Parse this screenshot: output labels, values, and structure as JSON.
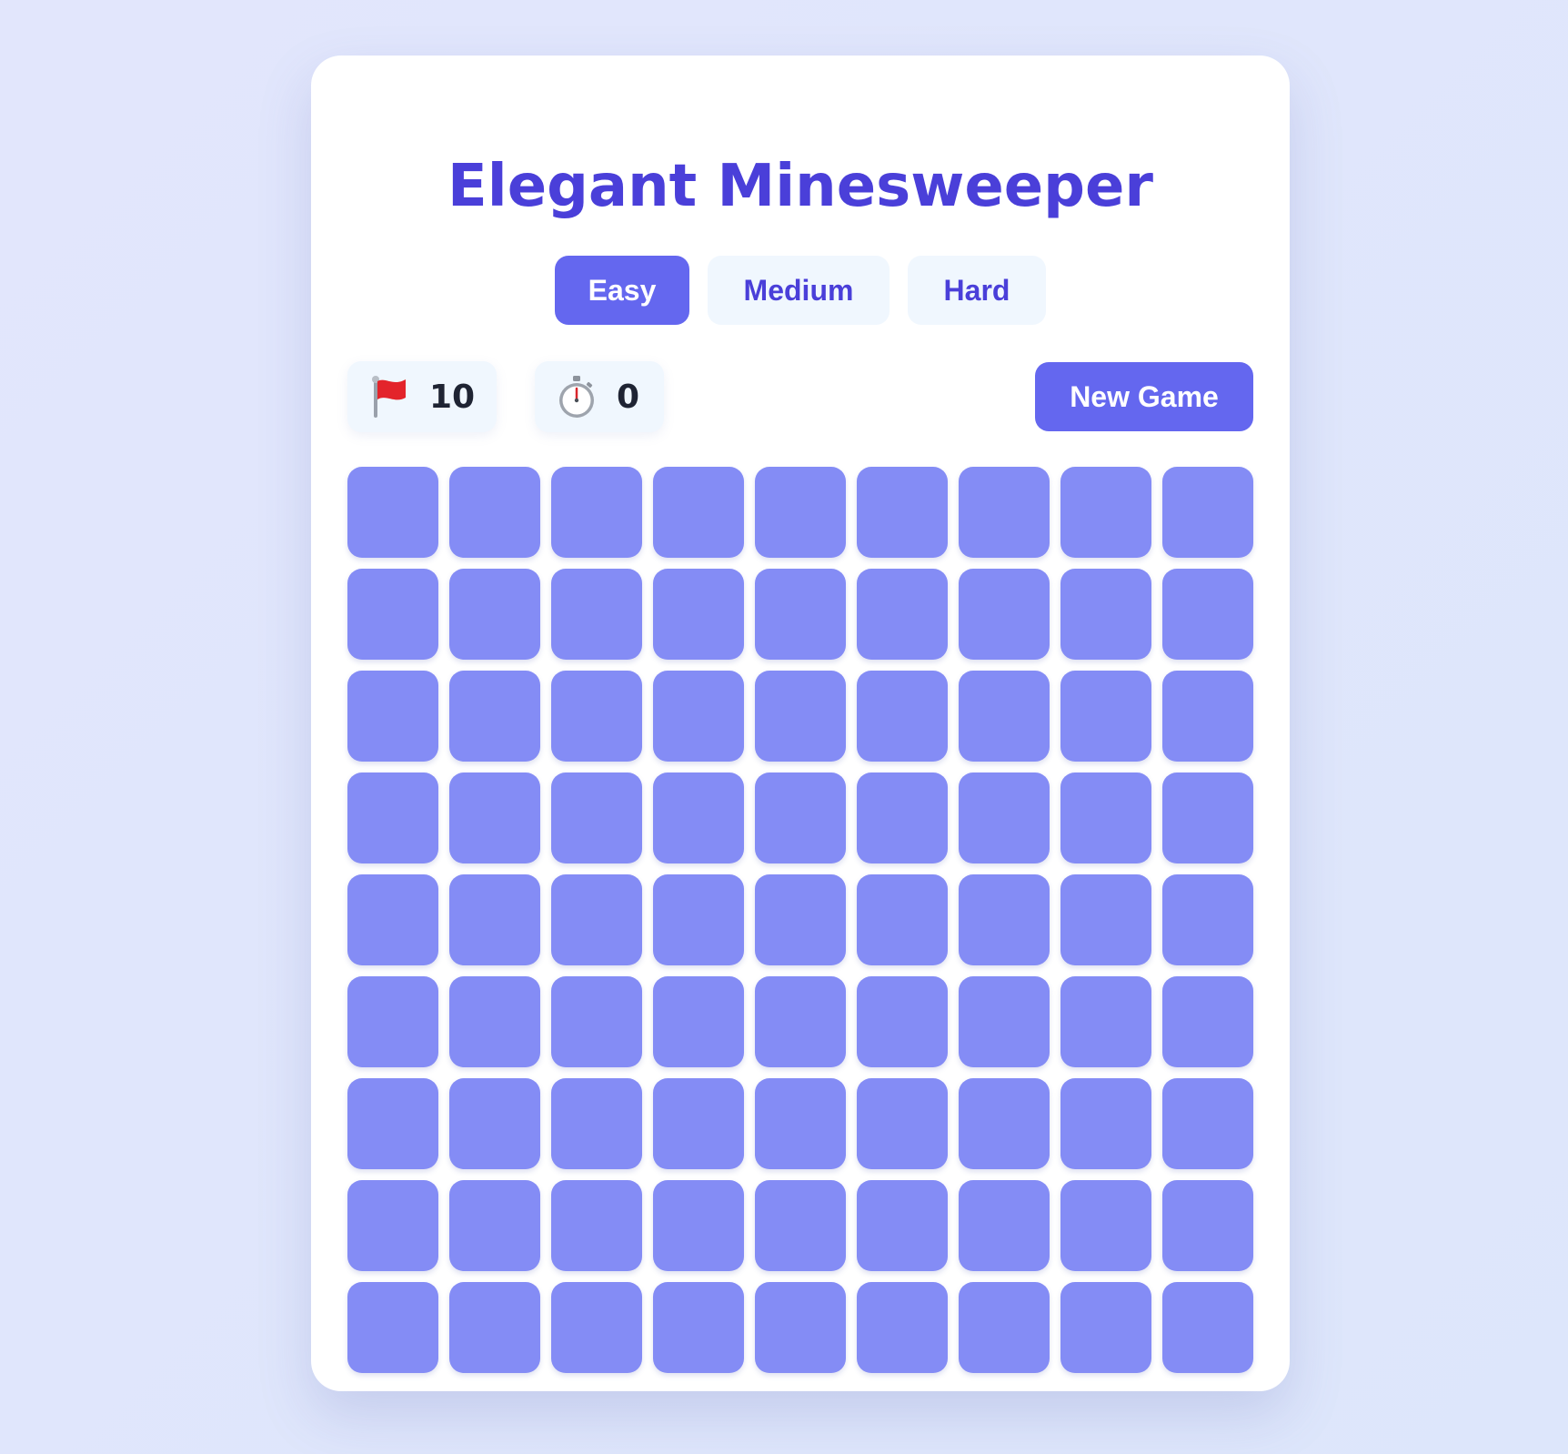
{
  "title": "Elegant Minesweeper",
  "difficulty": {
    "options": [
      {
        "label": "Easy",
        "selected": true
      },
      {
        "label": "Medium",
        "selected": false
      },
      {
        "label": "Hard",
        "selected": false
      }
    ]
  },
  "stats": {
    "flags": {
      "icon": "red-flag-icon",
      "value": "10"
    },
    "timer": {
      "icon": "stopwatch-icon",
      "value": "0"
    }
  },
  "new_game_label": "New Game",
  "board": {
    "rows": 9,
    "cols": 9,
    "cell_state": "unrevealed"
  },
  "colors": {
    "accent": "#6467ef",
    "title": "#4a3fd9",
    "cell": "#848cf5",
    "pill_bg": "#f0f7fe"
  }
}
